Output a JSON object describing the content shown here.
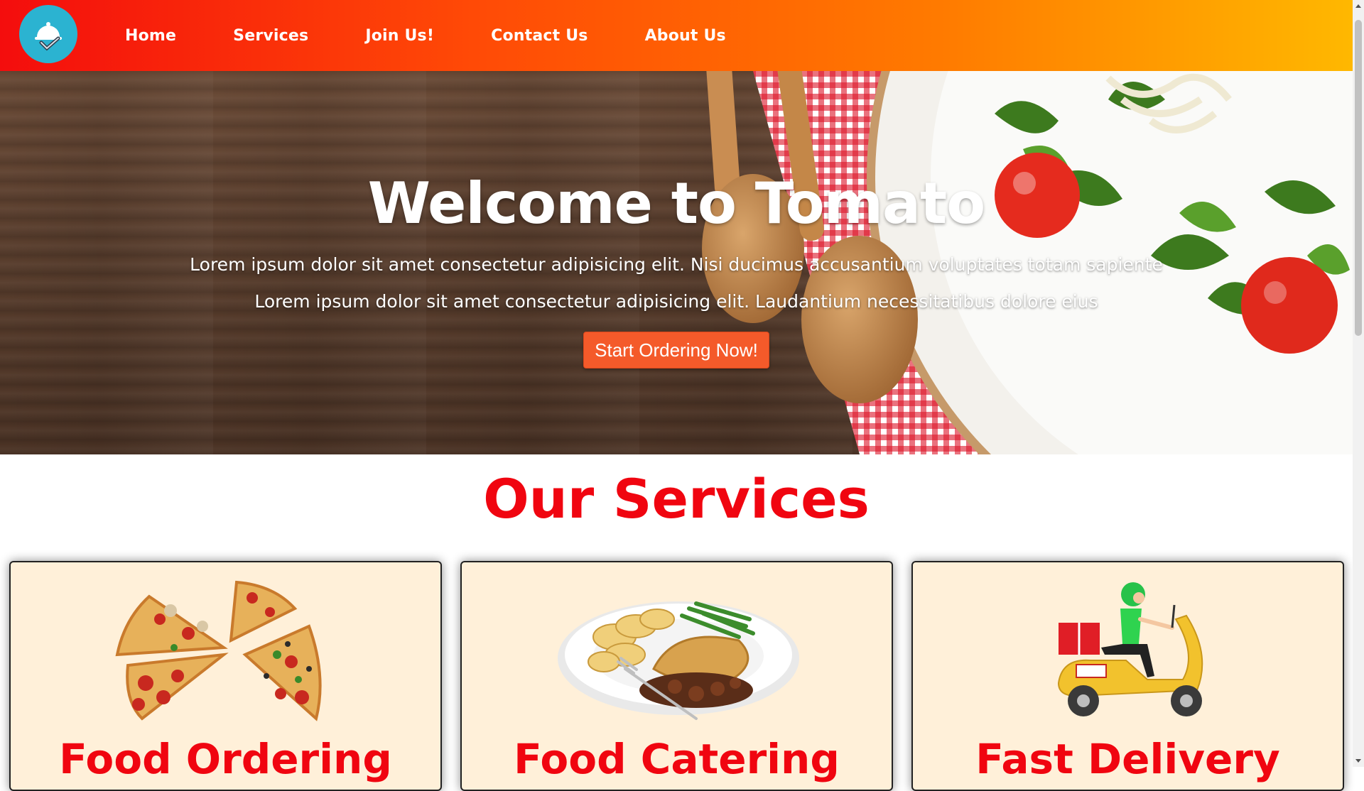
{
  "nav": {
    "logo_icon": "cloche-check-icon",
    "items": [
      {
        "label": "Home"
      },
      {
        "label": "Services"
      },
      {
        "label": "Join Us!"
      },
      {
        "label": "Contact Us"
      },
      {
        "label": "About Us"
      }
    ]
  },
  "hero": {
    "title": "Welcome to Tomato",
    "line1": "Lorem ipsum dolor sit amet consectetur adipisicing elit. Nisi ducimus accusantium voluptates totam sapiente",
    "line2": "Lorem ipsum dolor sit amet consectetur adipisicing elit. Laudantium necessitatibus dolore eius",
    "cta_label": "Start Ordering Now!"
  },
  "services": {
    "title": "Our Services",
    "cards": [
      {
        "title": "Food Ordering",
        "image": "pizza-slices-image"
      },
      {
        "title": "Food Catering",
        "image": "plated-meal-image"
      },
      {
        "title": "Fast Delivery",
        "image": "delivery-scooter-image"
      }
    ]
  },
  "colors": {
    "nav_gradient_start": "#f40d0d",
    "nav_gradient_end": "#ffb800",
    "accent_red": "#f00510",
    "cta": "#f45a2a",
    "card_bg": "#fff0d9",
    "logo_bg": "#2bb3d1"
  }
}
